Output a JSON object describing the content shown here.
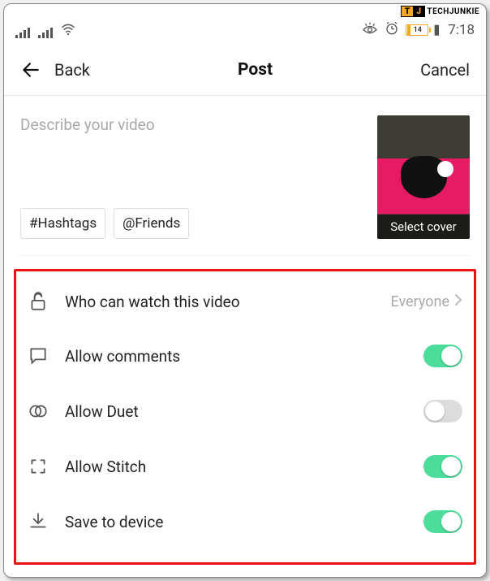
{
  "watermark": "TECHJUNKIE",
  "status": {
    "battery_pct": "14",
    "clock": "7:18"
  },
  "nav": {
    "back_label": "Back",
    "title": "Post",
    "cancel_label": "Cancel"
  },
  "compose": {
    "describe_placeholder": "Describe your video",
    "hashtag_label": "#Hashtags",
    "friends_label": "@Friends",
    "cover_label": "Select cover"
  },
  "settings": {
    "privacy": {
      "label": "Who can watch this video",
      "value": "Everyone"
    },
    "comments": {
      "label": "Allow comments",
      "on": true
    },
    "duet": {
      "label": "Allow Duet",
      "on": false
    },
    "stitch": {
      "label": "Allow Stitch",
      "on": true
    },
    "save": {
      "label": "Save to device",
      "on": true
    }
  }
}
